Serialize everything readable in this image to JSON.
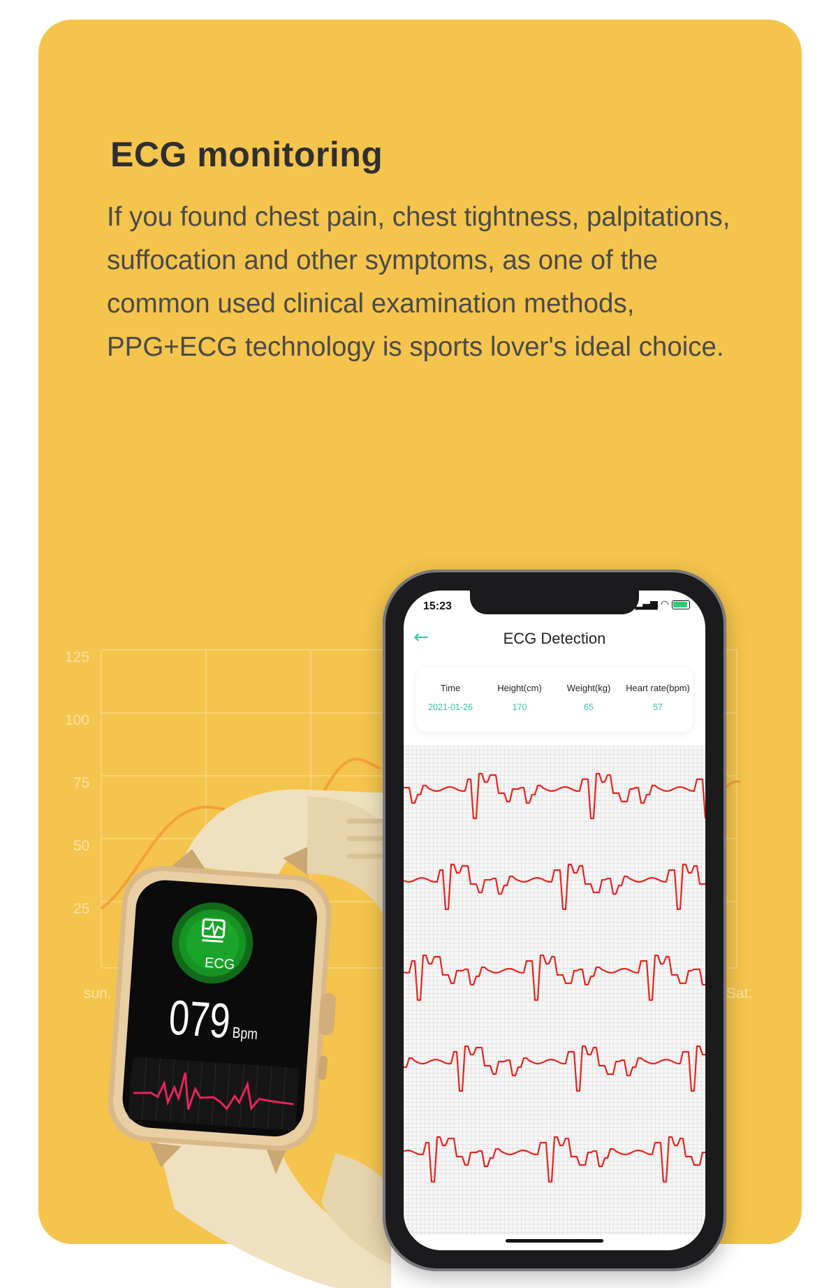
{
  "heading": "ECG monitoring",
  "body_lines": [
    "If you found chest pain, chest tightness, palpitations,",
    "suffocation and other symptoms, as one of the",
    "common used clinical examination methods,",
    "PPG+ECG technology is sports lover's ideal choice."
  ],
  "background_chart": {
    "y_ticks": [
      "125",
      "100",
      "75",
      "50",
      "25"
    ],
    "x_start_label": "sun.",
    "x_end_label": "Sat."
  },
  "watch": {
    "ecg_label": "ECG",
    "bpm_value": "079",
    "bpm_unit": "Bpm",
    "accent_color": "#1aa52a"
  },
  "phone": {
    "status_time": "15:23",
    "title": "ECG Detection",
    "columns": [
      {
        "label": "Time",
        "value": "2021-01-26"
      },
      {
        "label": "Height(cm)",
        "value": "170"
      },
      {
        "label": "Weight(kg)",
        "value": "65"
      },
      {
        "label": "Heart rate(bpm)",
        "value": "57"
      }
    ],
    "accent_color": "#35c2a8",
    "ecg_trace_color": "#e8231e"
  },
  "colors": {
    "card_background": "#f4c44c",
    "heading": "#2f2f2f"
  }
}
